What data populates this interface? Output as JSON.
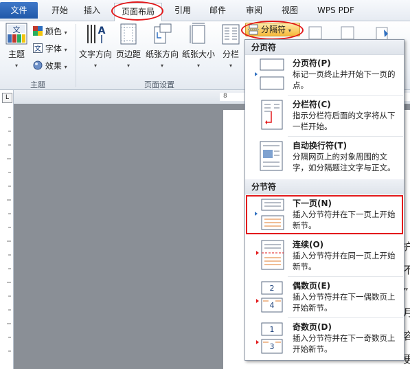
{
  "tabs": [
    {
      "label": "文件"
    },
    {
      "label": "开始"
    },
    {
      "label": "插入"
    },
    {
      "label": "页面布局"
    },
    {
      "label": "引用"
    },
    {
      "label": "邮件"
    },
    {
      "label": "审阅"
    },
    {
      "label": "视图"
    },
    {
      "label": "WPS PDF"
    }
  ],
  "ribbon": {
    "theme_group": {
      "label": "主题",
      "theme_button": "主题",
      "colors": "颜色",
      "fonts": "字体",
      "effects": "效果",
      "theme_icon_text": "文文"
    },
    "page_setup_group": {
      "label": "页面设置",
      "text_direction": "文字方向",
      "margins": "页边距",
      "orientation": "纸张方向",
      "size": "纸张大小",
      "columns": "分栏",
      "breaks": "分隔符",
      "text_direction_icon_text": "A"
    }
  },
  "ruler": {
    "corner_symbol": "L",
    "marker": "8"
  },
  "page_text": [
    "护",
    "不",
    "”",
    "月",
    "容",
    "更"
  ],
  "dropdown": {
    "page_break_header": "分页符",
    "section_break_header": "分节符",
    "items": [
      {
        "title": "分页符(P)",
        "desc": "标记一页终止并开始下一页的点。"
      },
      {
        "title": "分栏符(C)",
        "desc": "指示分栏符后面的文字将从下一栏开始。"
      },
      {
        "title": "自动换行符(T)",
        "desc": "分隔网页上的对象周围的文字，如分隔题注文字与正文。"
      },
      {
        "title": "下一页(N)",
        "desc": "插入分节符并在下一页上开始新节。"
      },
      {
        "title": "连续(O)",
        "desc": "插入分节符并在同一页上开始新节。"
      },
      {
        "title": "偶数页(E)",
        "desc": "插入分节符并在下一偶数页上开始新节。",
        "icon_top": "2",
        "icon_bottom": "4"
      },
      {
        "title": "奇数页(D)",
        "desc": "插入分节符并在下一奇数页上开始新节。",
        "icon_top": "1",
        "icon_bottom": "3"
      }
    ]
  },
  "colors": {
    "accent_red": "#e3191b",
    "file_tab_blue": "#2a63b5",
    "breaks_button_orange": "#f6b93b"
  }
}
